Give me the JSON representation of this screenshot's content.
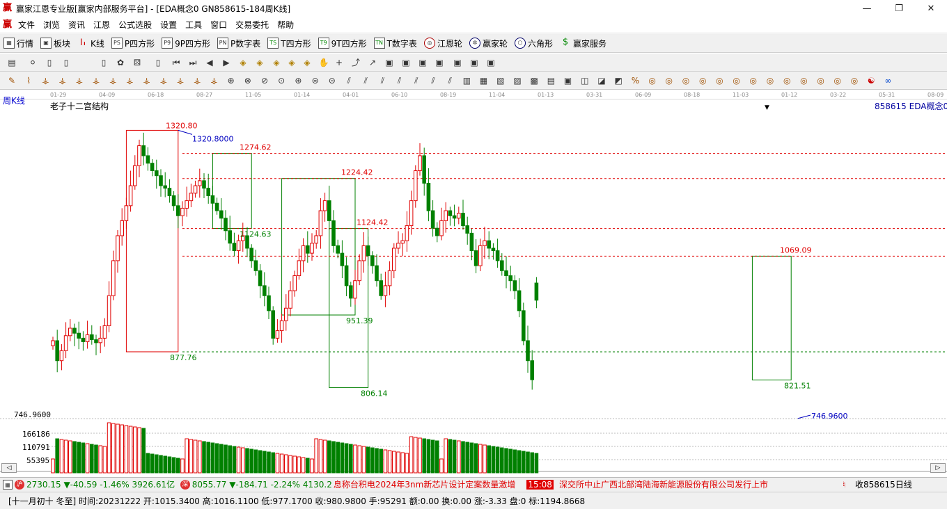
{
  "window": {
    "title": "赢家江恩专业版[赢家内部服务平台] - [EDA概念0  GN858615-184周K线]",
    "logo": "赢",
    "controls": [
      "—",
      "❐",
      "✕"
    ]
  },
  "menu": {
    "items": [
      "文件",
      "浏览",
      "资讯",
      "江恩",
      "公式选股",
      "设置",
      "工具",
      "窗口",
      "交易委托",
      "帮助"
    ]
  },
  "toolbar1": {
    "items": [
      {
        "label": "行情",
        "icon": "grid-icon"
      },
      {
        "label": "板块",
        "icon": "blocks-icon"
      },
      {
        "label": "K线",
        "icon": "candle-icon"
      },
      {
        "label": "P四方形",
        "icon": "P",
        "icon_text": "PS"
      },
      {
        "label": "9P四方形",
        "icon": "9P",
        "icon_text": "P9"
      },
      {
        "label": "P数字表",
        "icon": "PN",
        "icon_text": "PN"
      },
      {
        "label": "T四方形",
        "icon": "TS",
        "icon_text": "TS"
      },
      {
        "label": "9T四方形",
        "icon": "T9",
        "icon_text": "T9"
      },
      {
        "label": "T数字表",
        "icon": "TN",
        "icon_text": "TN"
      },
      {
        "label": "江恩轮",
        "icon": "wheel-icon"
      },
      {
        "label": "赢家轮",
        "icon": "wheel2-icon"
      },
      {
        "label": "六角形",
        "icon": "hexagon-icon"
      },
      {
        "label": "赢家服务",
        "icon": "dollar-icon"
      }
    ]
  },
  "chart": {
    "period_label": "周K线",
    "indicator_title": "老子十二宫结构",
    "instrument_label": "858615 EDA概念0",
    "date_ticks": [
      "01-29",
      "04-09",
      "06-18",
      "08-27",
      "11-05",
      "01-14",
      "04-01",
      "06-10",
      "08-19",
      "11-04",
      "01-13",
      "03-31",
      "06-09",
      "08-18",
      "11-03",
      "01-12",
      "03-22",
      "05-31",
      "08-09"
    ],
    "price_labels": [
      {
        "text": "1320.80",
        "color": "red"
      },
      {
        "text": "1320.8000",
        "color": "blue"
      },
      {
        "text": "1274.62",
        "color": "red"
      },
      {
        "text": "1224.42",
        "color": "red"
      },
      {
        "text": "1124.42",
        "color": "red"
      },
      {
        "text": "1124.63",
        "color": "green"
      },
      {
        "text": "1069.09",
        "color": "red"
      },
      {
        "text": "877.76",
        "color": "green"
      },
      {
        "text": "951.39",
        "color": "green"
      },
      {
        "text": "806.14",
        "color": "green"
      },
      {
        "text": "821.51",
        "color": "green"
      },
      {
        "text": "746.9600",
        "color": "blue"
      }
    ],
    "left_axis_price": "746.9600",
    "volume_axis": [
      "166186",
      "110791",
      "55395"
    ],
    "colors": {
      "up": "#e00000",
      "down": "#008000",
      "grid": "#c8c8c8",
      "box_red": "#e00000",
      "box_green": "#008000"
    }
  },
  "chart_data": {
    "type": "candlestick",
    "title": "老子十二宫结构",
    "period": "周K线",
    "instrument": "858615 EDA概念0",
    "ylim": [
      746.96,
      1345
    ],
    "key_levels": [
      1320.8,
      1274.62,
      1224.42,
      1124.42,
      1124.63,
      1069.09,
      951.39,
      877.76,
      821.51,
      806.14,
      746.96
    ],
    "last_bar": {
      "open": 1015.34,
      "high": 1016.11,
      "low": 977.17,
      "close": 980.98
    },
    "closes": [
      900,
      860,
      880,
      910,
      925,
      915,
      905,
      898,
      912,
      902,
      896,
      905,
      930,
      990,
      1060,
      1110,
      1140,
      1170,
      1210,
      1250,
      1290,
      1270,
      1255,
      1240,
      1230,
      1210,
      1205,
      1190,
      1170,
      1150,
      1165,
      1180,
      1195,
      1210,
      1220,
      1205,
      1190,
      1175,
      1160,
      1145,
      1120,
      1095,
      1080,
      1100,
      1110,
      1085,
      1060,
      1040,
      1010,
      990,
      960,
      905,
      920,
      940,
      965,
      1000,
      1030,
      1060,
      1090,
      1075,
      1095,
      1110,
      1160,
      1180,
      1140,
      1090,
      1075,
      1050,
      1010,
      985,
      1020,
      1060,
      1090,
      1070,
      1050,
      1020,
      990,
      1010,
      1040,
      1085,
      1095,
      1100,
      1130,
      1180,
      1240,
      1270,
      1215,
      1160,
      1125,
      1110,
      1140,
      1160,
      1150,
      1145,
      1155,
      1130,
      1115,
      1080,
      1050,
      1090,
      1100,
      1085,
      1080,
      1060,
      1040,
      1030,
      1020,
      1000,
      960,
      900,
      860,
      822,
      980.98
    ]
  },
  "status": {
    "sh_index": "2730.15",
    "sh_change": "▼-40.59",
    "sh_pct": "-1.46%",
    "sh_amount": "3926.61亿",
    "sz_badge": "深",
    "sz_index": "8055.77",
    "sz_change": "▼-184.71",
    "sz_pct": "-2.24%",
    "sz_amount": "4130.2",
    "news1": "息称台积电2024年3nm新芯片设计定案数量激增",
    "news_time": "15:08",
    "news2": "深交所中止广西北部湾陆海新能源股份有限公司发行上市",
    "right_label": "收858615日线"
  },
  "infobar": {
    "text": "[十一月初十 冬至] 时间:20231222 开:1015.3400 高:1016.1100 低:977.1700 收:980.9800 手:95291 额:0.00 换:0.00 涨:-3.33 盘:0 标:1194.8668"
  }
}
